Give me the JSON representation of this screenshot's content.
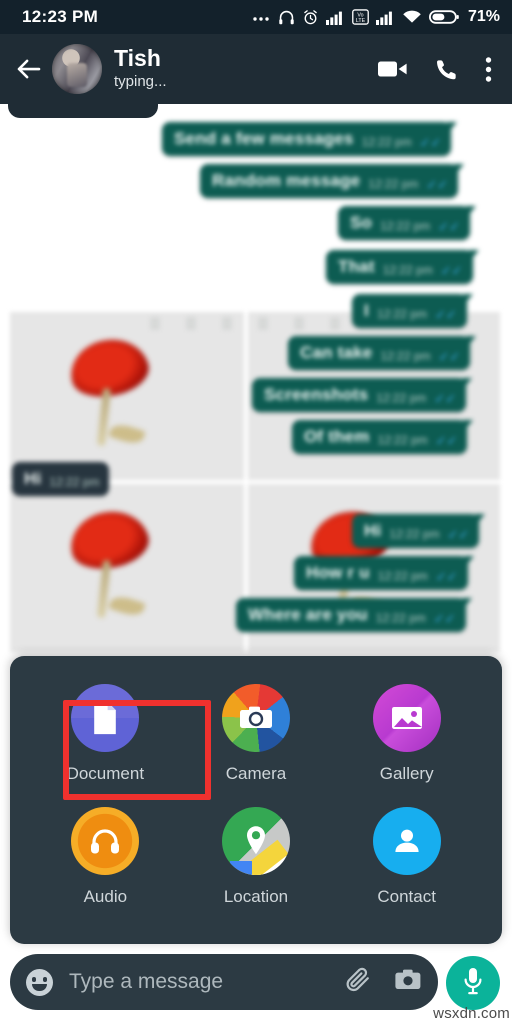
{
  "statusbar": {
    "clock": "12:23 PM",
    "battery_text": "71%",
    "icons": [
      "more-dots-icon",
      "headphones-icon",
      "alarm-icon",
      "signal-icon",
      "volte-icon",
      "signal-2-icon",
      "wifi-icon",
      "battery-icon"
    ],
    "volte_top": "Vo",
    "volte_bottom": "LTE",
    "background": "#13212b"
  },
  "appbar": {
    "back_label": "back-arrow",
    "title": "Tish",
    "status": "typing...",
    "actions": [
      "video-call",
      "voice-call",
      "overflow-menu"
    ],
    "background": "#1f2c35"
  },
  "chat": {
    "bubble_out_color": "#0d5c52",
    "bubble_in_color": "#27353f",
    "tick_color": "#3ba9e8",
    "messages": [
      {
        "text": "Send a few messages",
        "time": "12:22 pm",
        "dir": "out",
        "ticks": "✓✓"
      },
      {
        "text": "Random message",
        "time": "12:22 pm",
        "dir": "out",
        "ticks": "✓✓"
      },
      {
        "text": "So",
        "time": "12:22 pm",
        "dir": "out",
        "ticks": "✓✓"
      },
      {
        "text": "That",
        "time": "12:22 pm",
        "dir": "out",
        "ticks": "✓✓"
      },
      {
        "text": "I",
        "time": "12:22 pm",
        "dir": "out",
        "ticks": "✓✓"
      },
      {
        "text": "Can take",
        "time": "12:22 pm",
        "dir": "out",
        "ticks": "✓✓"
      },
      {
        "text": "Screenshots",
        "time": "12:22 pm",
        "dir": "out",
        "ticks": "✓✓"
      },
      {
        "text": "Of them",
        "time": "12:22 pm",
        "dir": "out",
        "ticks": "✓✓"
      },
      {
        "text": "Hi",
        "time": "12:22 pm",
        "dir": "out",
        "ticks": "✓✓"
      },
      {
        "text": "How r u",
        "time": "12:22 pm",
        "dir": "out",
        "ticks": "✓✓"
      },
      {
        "text": "Where are you",
        "time": "12:22 pm",
        "dir": "out",
        "ticks": "✓✓"
      },
      {
        "text": "Hi",
        "time": "12:22 pm",
        "dir": "in",
        "ticks": ""
      }
    ]
  },
  "attachment_sheet": {
    "highlighted": "Document",
    "highlight_color": "#f0312e",
    "background": "#2c3a43",
    "options": [
      {
        "label": "Document",
        "icon": "document-icon",
        "color": "#6b6bd8"
      },
      {
        "label": "Camera",
        "icon": "camera-icon",
        "color": "#f0a21c"
      },
      {
        "label": "Gallery",
        "icon": "gallery-icon",
        "color": "#c94ddb"
      },
      {
        "label": "Audio",
        "icon": "audio-icon",
        "color": "#f6ad27"
      },
      {
        "label": "Location",
        "icon": "location-icon",
        "color": "#34a853"
      },
      {
        "label": "Contact",
        "icon": "contact-icon",
        "color": "#17aeef"
      }
    ]
  },
  "composer": {
    "placeholder": "Type a message",
    "value": "",
    "emoji_icon": "emoji-icon",
    "attach_icon": "paperclip-icon",
    "camera_icon": "camera-icon",
    "mic_icon": "microphone-icon",
    "mic_color": "#0bb39a"
  },
  "watermark": {
    "text": "wsxdn.com"
  }
}
